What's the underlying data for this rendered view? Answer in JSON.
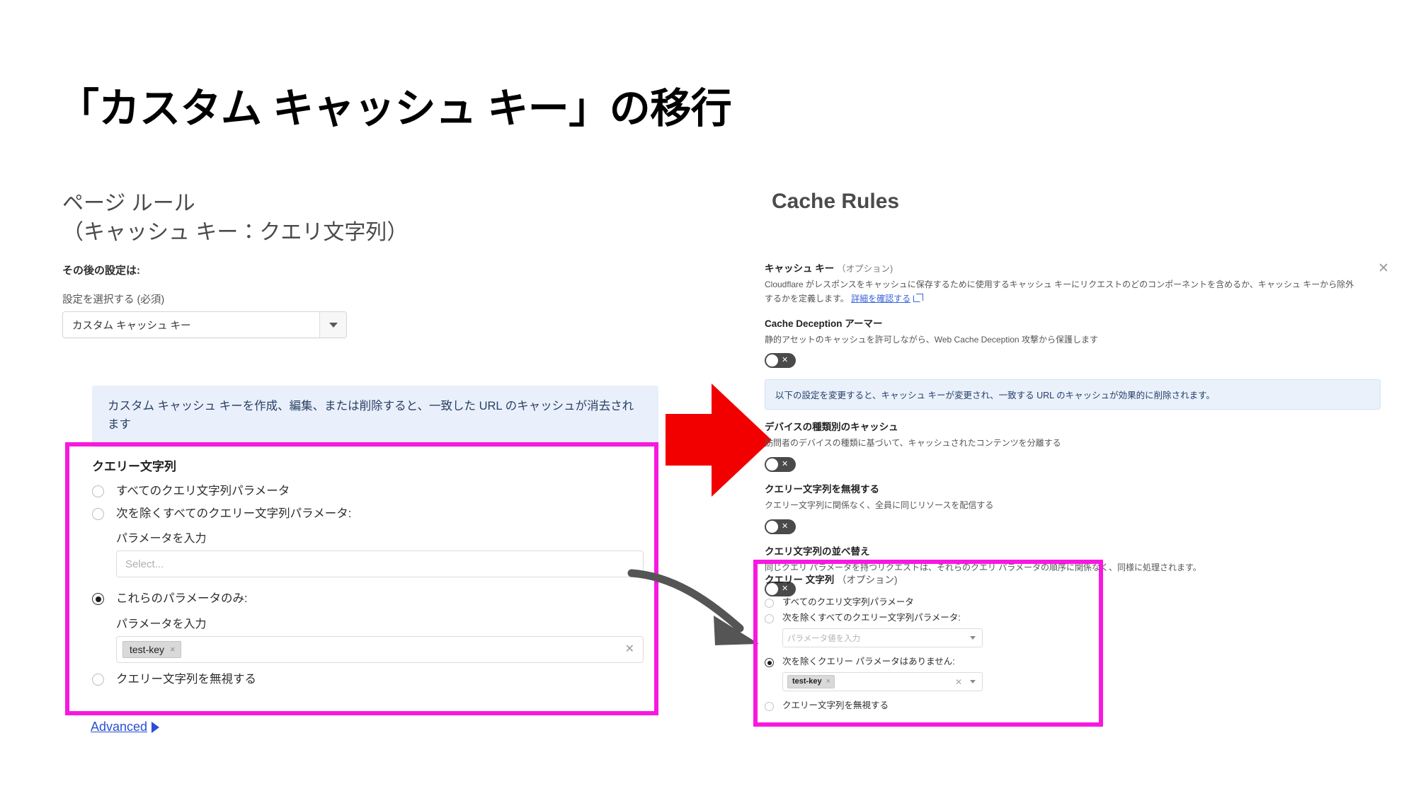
{
  "title": "「カスタム キャッシュ キー」の移行",
  "left": {
    "heading_line1": "ページ ルール",
    "heading_line2": "（キャッシュ キー：クエリ文字列）",
    "subheading": "その後の設定は:",
    "select_label": "設定を選択する (必須)",
    "select_value": "カスタム キャッシュ キー",
    "info_banner": "カスタム キャッシュ キーを作成、編集、または削除すると、一致した URL のキャッシュが消去されます",
    "query_group_title": "クエリー文字列",
    "radio_all": "すべてのクエリ文字列パラメータ",
    "radio_all_except": "次を除くすべてのクエリー文字列パラメータ:",
    "param_label_1": "パラメータを入力",
    "param_placeholder_1": "Select...",
    "radio_only_these": "これらのパラメータのみ:",
    "param_label_2": "パラメータを入力",
    "chip_value": "test-key",
    "chip_x": "×",
    "input_clear": "✕",
    "radio_ignore": "クエリー文字列を無視する",
    "advanced_link": "Advanced"
  },
  "right": {
    "heading": "Cache Rules",
    "close_icon": "✕",
    "cache_key": {
      "title": "キャッシュ キー",
      "optional": "（オプション)",
      "desc_part1": "Cloudflare がレスポンスをキャッシュに保存するために使用するキャッシュ キーにリクエストのどのコンポーネントを含めるか、キャッシュ キーから除外するかを定義します。",
      "desc_link": "詳細を確認する"
    },
    "deception": {
      "title": "Cache Deception アーマー",
      "desc": "静的アセットのキャッシュを許可しながら、Web Cache Deception 攻撃から保護します",
      "toggle_state": "off",
      "toggle_glyph": "✕"
    },
    "info_banner": "以下の設定を変更すると、キャッシュ キーが変更され、一致する URL のキャッシュが効果的に削除されます。",
    "device_type": {
      "title": "デバイスの種類別のキャッシュ",
      "desc": "訪問者のデバイスの種類に基づいて、キャッシュされたコンテンツを分離する",
      "toggle_glyph": "✕"
    },
    "ignore_qs": {
      "title": "クエリー文字列を無視する",
      "desc": "クエリー文字列に関係なく、全員に同じリソースを配信する",
      "toggle_glyph": "✕"
    },
    "sort_qs": {
      "title": "クエリ文字列の並べ替え",
      "desc": "同じクエリ パラメータを持つリクエストは、それらのクエリ パラメータの順序に関係なく、同様に処理されます。",
      "toggle_glyph": "✕"
    },
    "query_string": {
      "title": "クエリー 文字列",
      "optional": "（オプション)",
      "radio_all": "すべてのクエリ文字列パラメータ",
      "radio_all_except": "次を除くすべてのクエリー文字列パラメータ:",
      "placeholder": "パラメータ値を入力",
      "radio_none_except": "次を除くクエリー パラメータはありません:",
      "chip_value": "test-key",
      "chip_x": "×",
      "clear_icon": "✕",
      "radio_ignore": "クエリー文字列を無視する"
    }
  },
  "colors": {
    "highlight": "#f818e0",
    "red_arrow": "#f20000",
    "curve_arrow": "#555555",
    "link": "#2a4fd6",
    "info_bg": "#e9f0fb"
  }
}
